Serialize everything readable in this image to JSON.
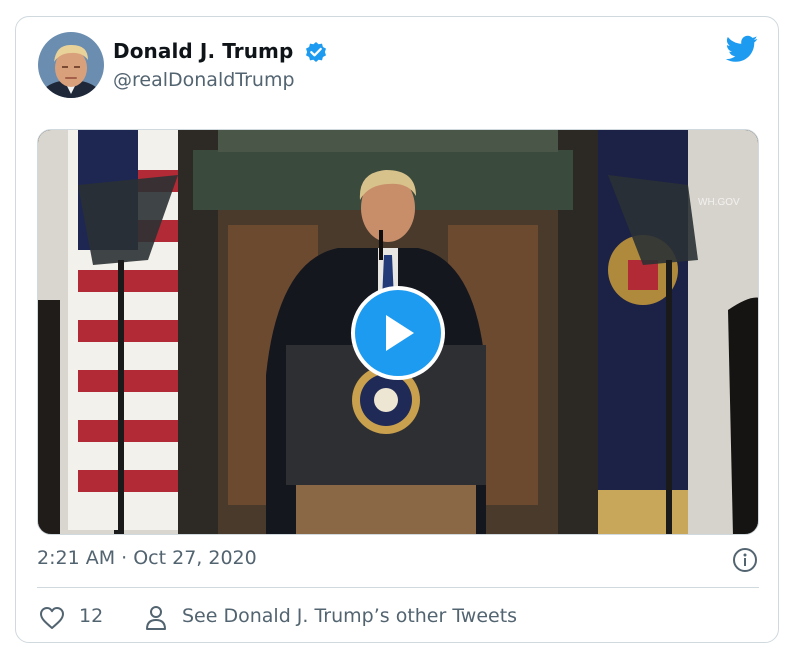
{
  "tweet": {
    "author_name": "Donald J. Trump",
    "handle": "@realDonaldTrump",
    "timestamp": "2:21 AM · Oct 27, 2020",
    "likes": "12",
    "other_tweets_link": "See Donald J. Trump’s other Tweets"
  },
  "media": {
    "watermark": "WH.GOV"
  },
  "icons": {
    "verified": "verified-badge-icon",
    "brand": "twitter-bird-icon",
    "play": "play-icon",
    "info": "info-icon",
    "like": "heart-icon",
    "profile": "person-icon"
  },
  "colors": {
    "accent": "#1d9bf0",
    "text_primary": "#0f1419",
    "text_secondary": "#536471",
    "border": "#cfd9de"
  }
}
